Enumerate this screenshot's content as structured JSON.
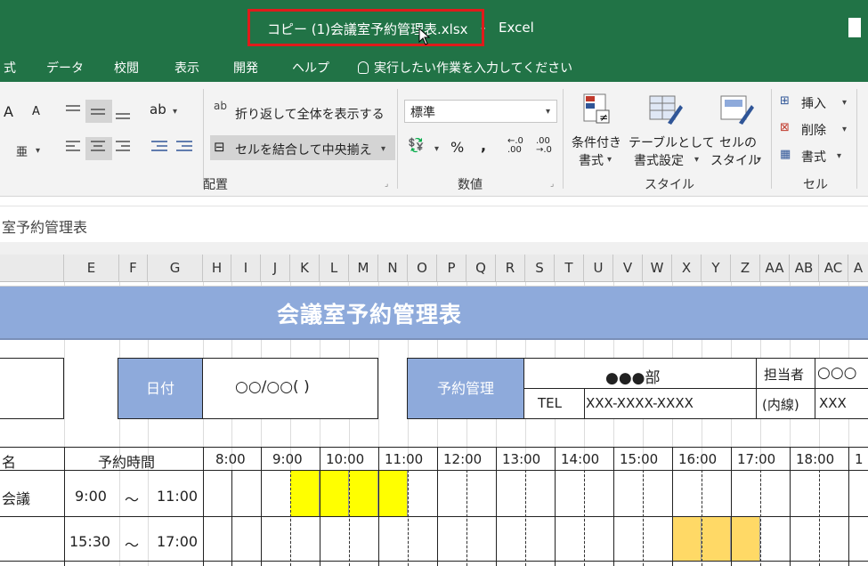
{
  "title": {
    "file": "コピー (1)会議室予約管理表.xlsx",
    "separator": "-",
    "app": "Excel"
  },
  "tabs": [
    "式",
    "データ",
    "校閲",
    "表示",
    "開発",
    "ヘルプ"
  ],
  "tell_me": "実行したい作業を入力してください",
  "ribbon": {
    "font_grow": "A",
    "font_shrink": "A",
    "phonetic_label": "亜",
    "wrap_label": "折り返して全体を表示する",
    "wrap_icon": "ab",
    "merge_label": "セルを結合して中央揃え",
    "number_format": "標準",
    "percent": "%",
    "comma": ",",
    "cond_format": [
      "条件付き",
      "書式"
    ],
    "table_format": [
      "テーブルとして",
      "書式設定"
    ],
    "cell_style": [
      "セルの",
      "スタイル"
    ],
    "insert": "挿入",
    "delete": "削除",
    "format": "書式",
    "groups": {
      "alignment": "配置",
      "number": "数値",
      "styles": "スタイル",
      "cells": "セル"
    }
  },
  "name_box": "室予約管理表",
  "columns": [
    "E",
    "F",
    "G",
    "H",
    "I",
    "J",
    "K",
    "L",
    "M",
    "N",
    "O",
    "P",
    "Q",
    "R",
    "S",
    "T",
    "U",
    "V",
    "W",
    "X",
    "Y",
    "Z",
    "AA",
    "AB",
    "AC",
    "A"
  ],
  "sheet": {
    "banner": "会議室予約管理表",
    "date_label": "日付",
    "date_value": "○○/○○( )",
    "manager_label": "予約管理",
    "department": "●●●部",
    "tel_label": "TEL",
    "tel_value": "XXX-XXXX-XXXX",
    "person_label": "担当者",
    "person_value": "○○○",
    "ext_label": "(内線)",
    "ext_value": "XXX",
    "name_header": "名",
    "time_header": "予約時間",
    "hours": [
      "8:00",
      "9:00",
      "10:00",
      "11:00",
      "12:00",
      "13:00",
      "14:00",
      "15:00",
      "16:00",
      "17:00",
      "18:00",
      "1"
    ],
    "rows": [
      {
        "name": "会議",
        "start": "9:00",
        "tilde": "〜",
        "end": "11:00"
      },
      {
        "name": "",
        "start": "15:30",
        "tilde": "〜",
        "end": "17:00"
      }
    ]
  },
  "colors": {
    "excel_green": "#217346",
    "header_blue": "#8eaadb",
    "booking_yellow": "#ffff00",
    "booking_orange": "#ffd966",
    "title_highlight": "#e01b1b"
  }
}
